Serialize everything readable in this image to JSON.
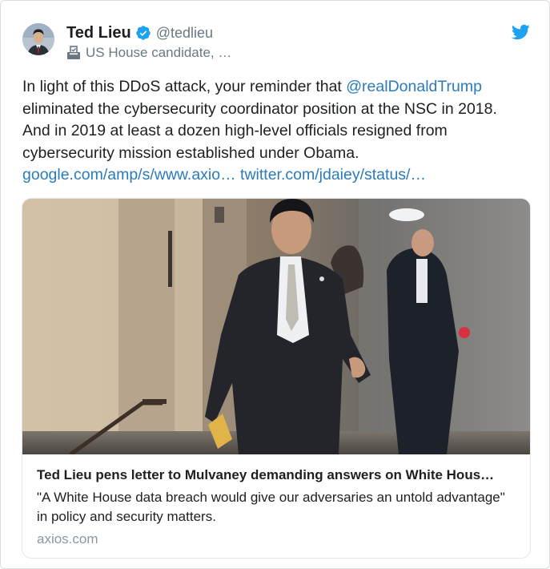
{
  "tweet": {
    "author_name": "Ted Lieu",
    "handle": "@tedlieu",
    "author_label": "US House candidate, …",
    "text_before_mention": "In light of this DDoS attack, your reminder that ",
    "mention": "@realDonaldTrump",
    "text_after_mention": " eliminated the cybersecurity coordinator position at the NSC in 2018. And in 2019 at least a dozen high-level officials resigned from cybersecurity mission established under Obama.",
    "link_1": "google.com/amp/s/www.axio…",
    "link_2": "twitter.com/jdaiey/status/…"
  },
  "link_card": {
    "title": "Ted Lieu pens letter to Mulvaney demanding answers on White Hous…",
    "description": "\"A White House data breach would give our adversaries an untold advantage\" in policy and security matters.",
    "domain": "axios.com"
  },
  "icons": {
    "verified": "verified-badge-icon",
    "label": "ballot-box-icon",
    "brand": "twitter-bird-icon"
  },
  "colors": {
    "link": "#2b7bb9",
    "verified": "#1da1f2",
    "brand": "#1da1f2",
    "secondary_text": "#697882",
    "domain_text": "#8899a6"
  }
}
